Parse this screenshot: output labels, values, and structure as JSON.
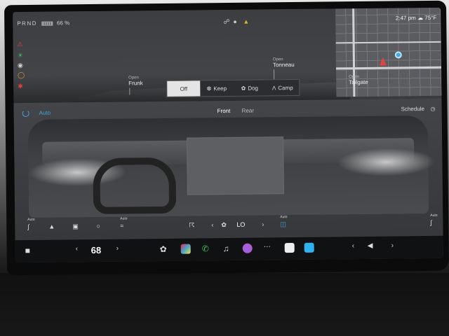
{
  "status": {
    "gear": "PRND",
    "battery_percent": "66 %",
    "time": "2:47 pm",
    "temperature": "75°F"
  },
  "doors": {
    "frunk": {
      "state": "Open",
      "name": "Frunk"
    },
    "tonneau": {
      "state": "Open",
      "name": "Tonneau"
    },
    "tailgate": {
      "state": "Open",
      "name": "Tailgate"
    }
  },
  "modes": [
    {
      "label": "Off",
      "icon": "off-icon",
      "selected": true
    },
    {
      "label": "Keep",
      "icon": "keep-icon",
      "selected": false
    },
    {
      "label": "Dog",
      "icon": "paw-icon",
      "selected": false
    },
    {
      "label": "Camp",
      "icon": "tent-icon",
      "selected": false
    }
  ],
  "climate": {
    "auto": "Auto",
    "front": "Front",
    "rear": "Rear",
    "schedule": "Schedule",
    "fan": "LO",
    "seat_left_auto": "Auto",
    "heated_auto": "Auto",
    "recirc_auto": "Auto",
    "seat_right_auto": "Auto"
  },
  "taskbar": {
    "cabin_temp": "68"
  },
  "colors": {
    "accent": "#3fa9e0",
    "warning_red": "#e04040",
    "warning_green": "#3cc35a",
    "warning_orange": "#e89a2c"
  }
}
